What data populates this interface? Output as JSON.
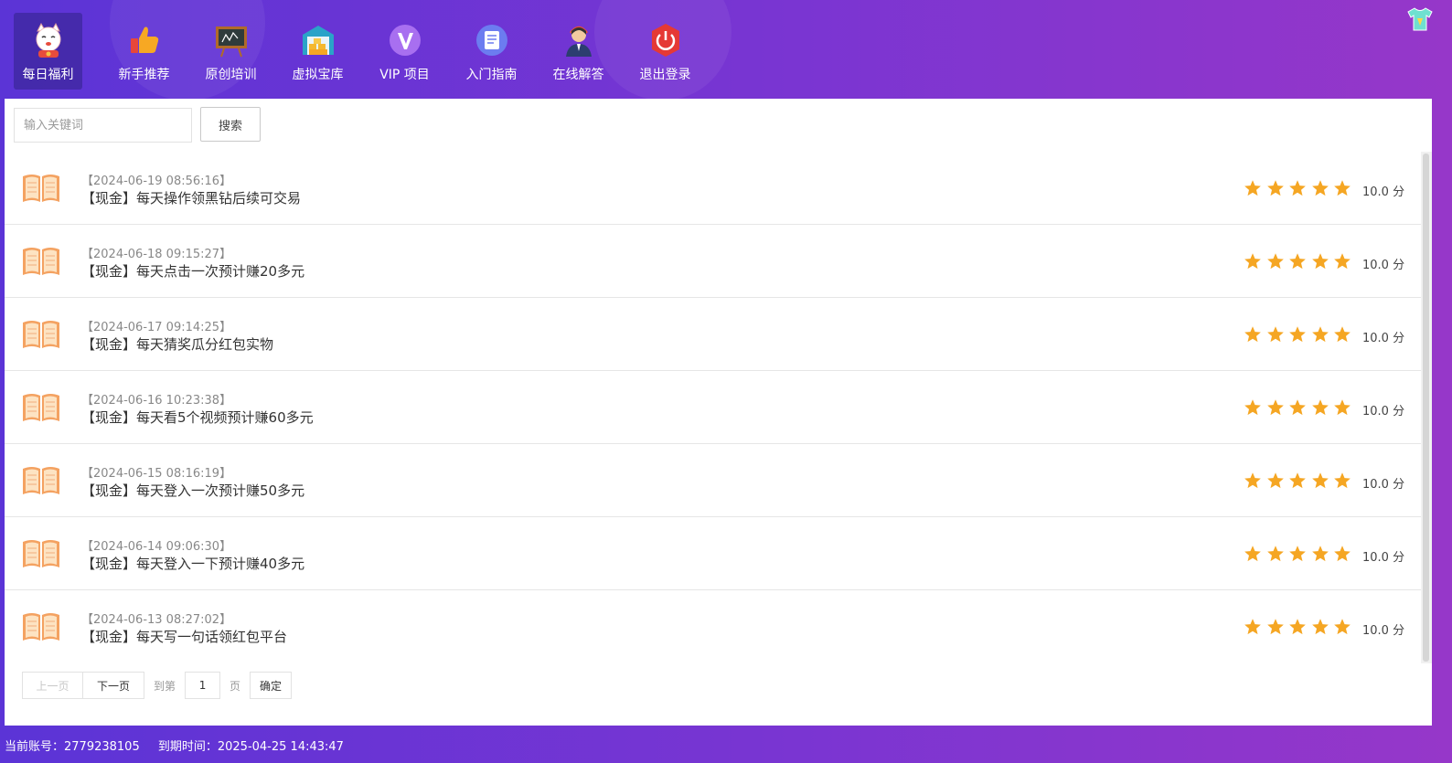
{
  "nav": {
    "items": [
      {
        "label": "每日福利",
        "icon": "lucky-cat-icon"
      },
      {
        "label": "新手推荐",
        "icon": "thumbs-up-icon"
      },
      {
        "label": "原创培训",
        "icon": "blackboard-icon"
      },
      {
        "label": "虚拟宝库",
        "icon": "warehouse-icon"
      },
      {
        "label": "VIP 项目",
        "icon": "vip-icon"
      },
      {
        "label": "入门指南",
        "icon": "document-icon"
      },
      {
        "label": "在线解答",
        "icon": "support-agent-icon"
      },
      {
        "label": "退出登录",
        "icon": "power-icon"
      }
    ],
    "active_index": 0
  },
  "search": {
    "placeholder": "输入关键词",
    "button_label": "搜索"
  },
  "list": {
    "items": [
      {
        "date": "【2024-06-19 08:56:16】",
        "title": "【现金】每天操作领黑钻后续可交易",
        "stars": 5,
        "score": "10.0 分"
      },
      {
        "date": "【2024-06-18 09:15:27】",
        "title": "【现金】每天点击一次预计赚20多元",
        "stars": 5,
        "score": "10.0 分"
      },
      {
        "date": "【2024-06-17 09:14:25】",
        "title": "【现金】每天猜奖瓜分红包实物",
        "stars": 5,
        "score": "10.0 分"
      },
      {
        "date": "【2024-06-16 10:23:38】",
        "title": "【现金】每天看5个视频预计赚60多元",
        "stars": 5,
        "score": "10.0 分"
      },
      {
        "date": "【2024-06-15 08:16:19】",
        "title": "【现金】每天登入一次预计赚50多元",
        "stars": 5,
        "score": "10.0 分"
      },
      {
        "date": "【2024-06-14 09:06:30】",
        "title": "【现金】每天登入一下预计赚40多元",
        "stars": 5,
        "score": "10.0 分"
      },
      {
        "date": "【2024-06-13 08:27:02】",
        "title": "【现金】每天写一句话领红包平台",
        "stars": 5,
        "score": "10.0 分"
      }
    ]
  },
  "pager": {
    "prev_label": "上一页",
    "next_label": "下一页",
    "goto_label": "到第",
    "page_value": "1",
    "page_suffix": "页",
    "confirm_label": "确定"
  },
  "footer": {
    "account": "当前账号：2779238105",
    "expire": "到期时间：2025-04-25 14:43:47"
  },
  "colors": {
    "gradient_start": "#5b34d6",
    "gradient_end": "#9637c9",
    "star": "#f5a623",
    "book": "#f4a261"
  }
}
